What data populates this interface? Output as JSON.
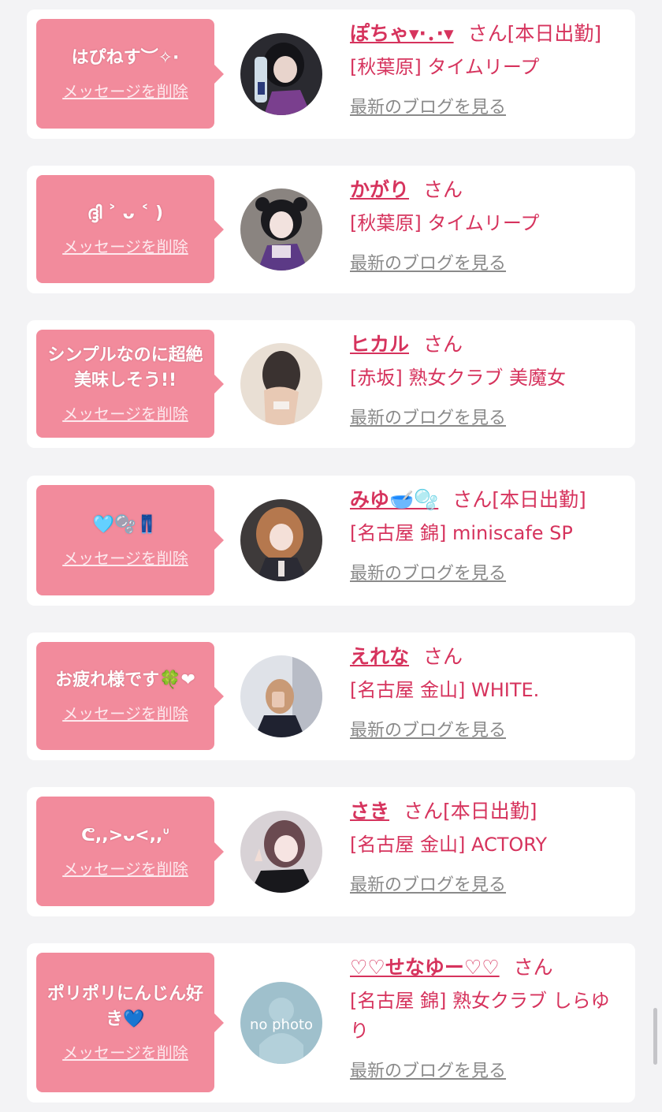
{
  "delete_label": "メッセージを削除",
  "blog_label": "最新のブログを見る",
  "san_label": "さん",
  "cards": [
    {
      "message": "はぴねす︶✧·",
      "name": "ぽちゃ▾·．·▾",
      "badge": "[本日出勤]",
      "shop": "[秋葉原] タイムリープ"
    },
    {
      "message": "ദ്ദി ˃ ᴗ ˂ )",
      "name": "かがり",
      "badge": "",
      "shop": "[秋葉原] タイムリープ"
    },
    {
      "message": "シンプルなのに超絶美味しそう!!",
      "name": "ヒカル",
      "badge": "",
      "shop": "[赤坂] 熟女クラブ 美魔女"
    },
    {
      "message": "🩵🫧👖",
      "name": "みゆ🥣🫧",
      "badge": "[本日出勤]",
      "shop": "[名古屋 錦] miniscafe SP"
    },
    {
      "message": "お疲れ様です🍀❤",
      "name": "えれな",
      "badge": "",
      "shop": "[名古屋 金山] WHITE."
    },
    {
      "message": "ᕦ,,>ᴗ<,,ᐡ",
      "name": "さき",
      "badge": "[本日出勤]",
      "shop": "[名古屋 金山] ACTORY"
    },
    {
      "message": "ポリポリにんじん好き💙",
      "name": "♡♡せなゆー♡♡",
      "badge": "",
      "shop": "[名古屋 錦] 熟女クラブ しらゆり",
      "avatar_text": "no photo"
    }
  ]
}
